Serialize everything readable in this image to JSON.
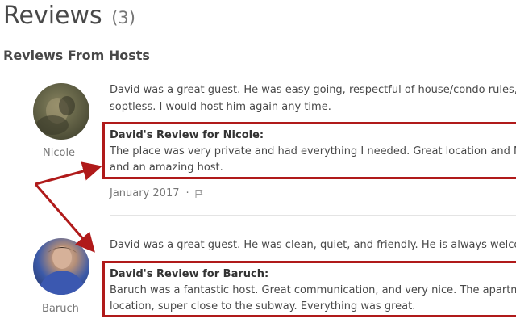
{
  "header": {
    "title": "Reviews",
    "count": "(3)"
  },
  "section": {
    "title": "Reviews From Hosts"
  },
  "reviews": [
    {
      "reviewer": "Nicole",
      "text_line1": "David was a great guest. He was easy going, respectful of house/condo rules, and left the place",
      "text_line2": "soptless. I would host him again any time.",
      "response_heading": "David's Review for Nicole:",
      "response_line1": "The place was very private and had everything I needed. Great location and Nicole was very friendly",
      "response_line2": "and an amazing host.",
      "date": "January 2017",
      "separator": "·"
    },
    {
      "reviewer": "Baruch",
      "text_line1": "David was a great guest. He was clean, quiet, and friendly. He is always welcome back!",
      "response_heading": "David's Review for Baruch:",
      "response_line1": "Baruch was a fantastic host. Great communication, and very nice. The apartment was in a great",
      "response_line2": "location, super close to the subway. Everything was great."
    }
  ],
  "annotation": {
    "color": "#b01a1a"
  },
  "icons": {
    "flag": "flag-icon"
  }
}
